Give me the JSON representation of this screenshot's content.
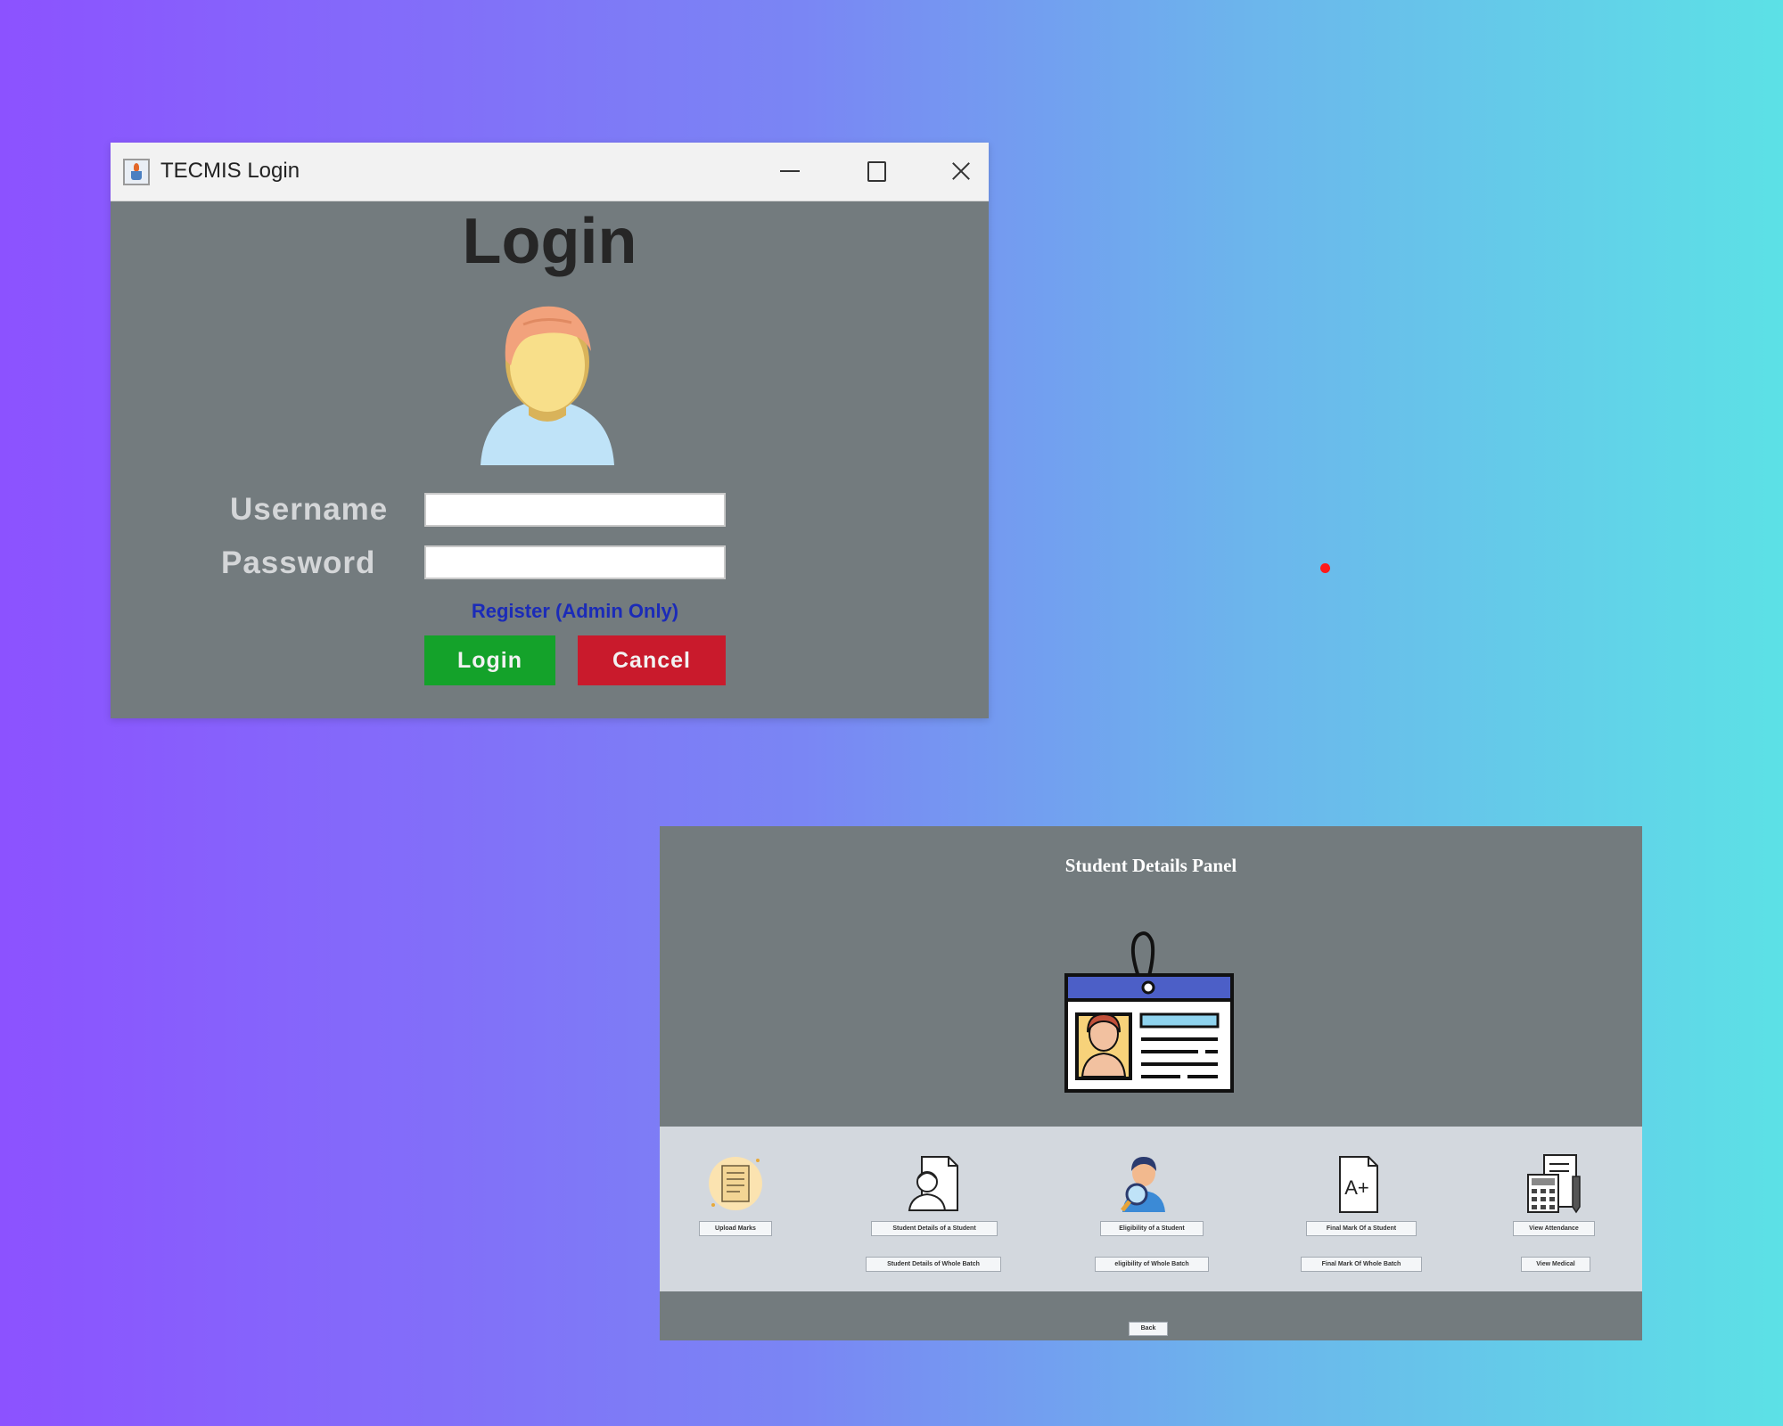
{
  "login_window": {
    "title": "TECMIS Login",
    "heading": "Login",
    "username_label": "Username",
    "password_label": "Password",
    "username_value": "",
    "password_value": "",
    "register_link": "Register (Admin Only)",
    "login_button": "Login",
    "cancel_button": "Cancel"
  },
  "student_panel": {
    "title": "Student Details Panel",
    "buttons": {
      "upload_marks": "Upload Marks",
      "student_details_student": "Student Details of a Student",
      "student_details_batch": "Student Details of Whole Batch",
      "eligibility_student": "Eligibility of a Student",
      "eligibility_batch": "eligibility of Whole Batch",
      "final_mark_student": "Final Mark Of a Student",
      "final_mark_batch": "Final Mark Of Whole Batch",
      "view_attendance": "View Attendance",
      "view_medical": "View Medical",
      "back": "Back"
    }
  },
  "colors": {
    "window_bg": "#737b7e",
    "login_green": "#14a22a",
    "cancel_red": "#c91a2c",
    "link_blue": "#1b2bb8",
    "strip_bg": "#d3d8de",
    "id_card_header": "#4c5fc7"
  },
  "icons": [
    "app-icon",
    "minimize-icon",
    "maximize-icon",
    "close-icon",
    "user-avatar-icon",
    "id-card-icon",
    "upload-marks-icon",
    "student-profile-icon",
    "eligibility-search-icon",
    "grade-a-plus-icon",
    "attendance-calculator-icon"
  ]
}
